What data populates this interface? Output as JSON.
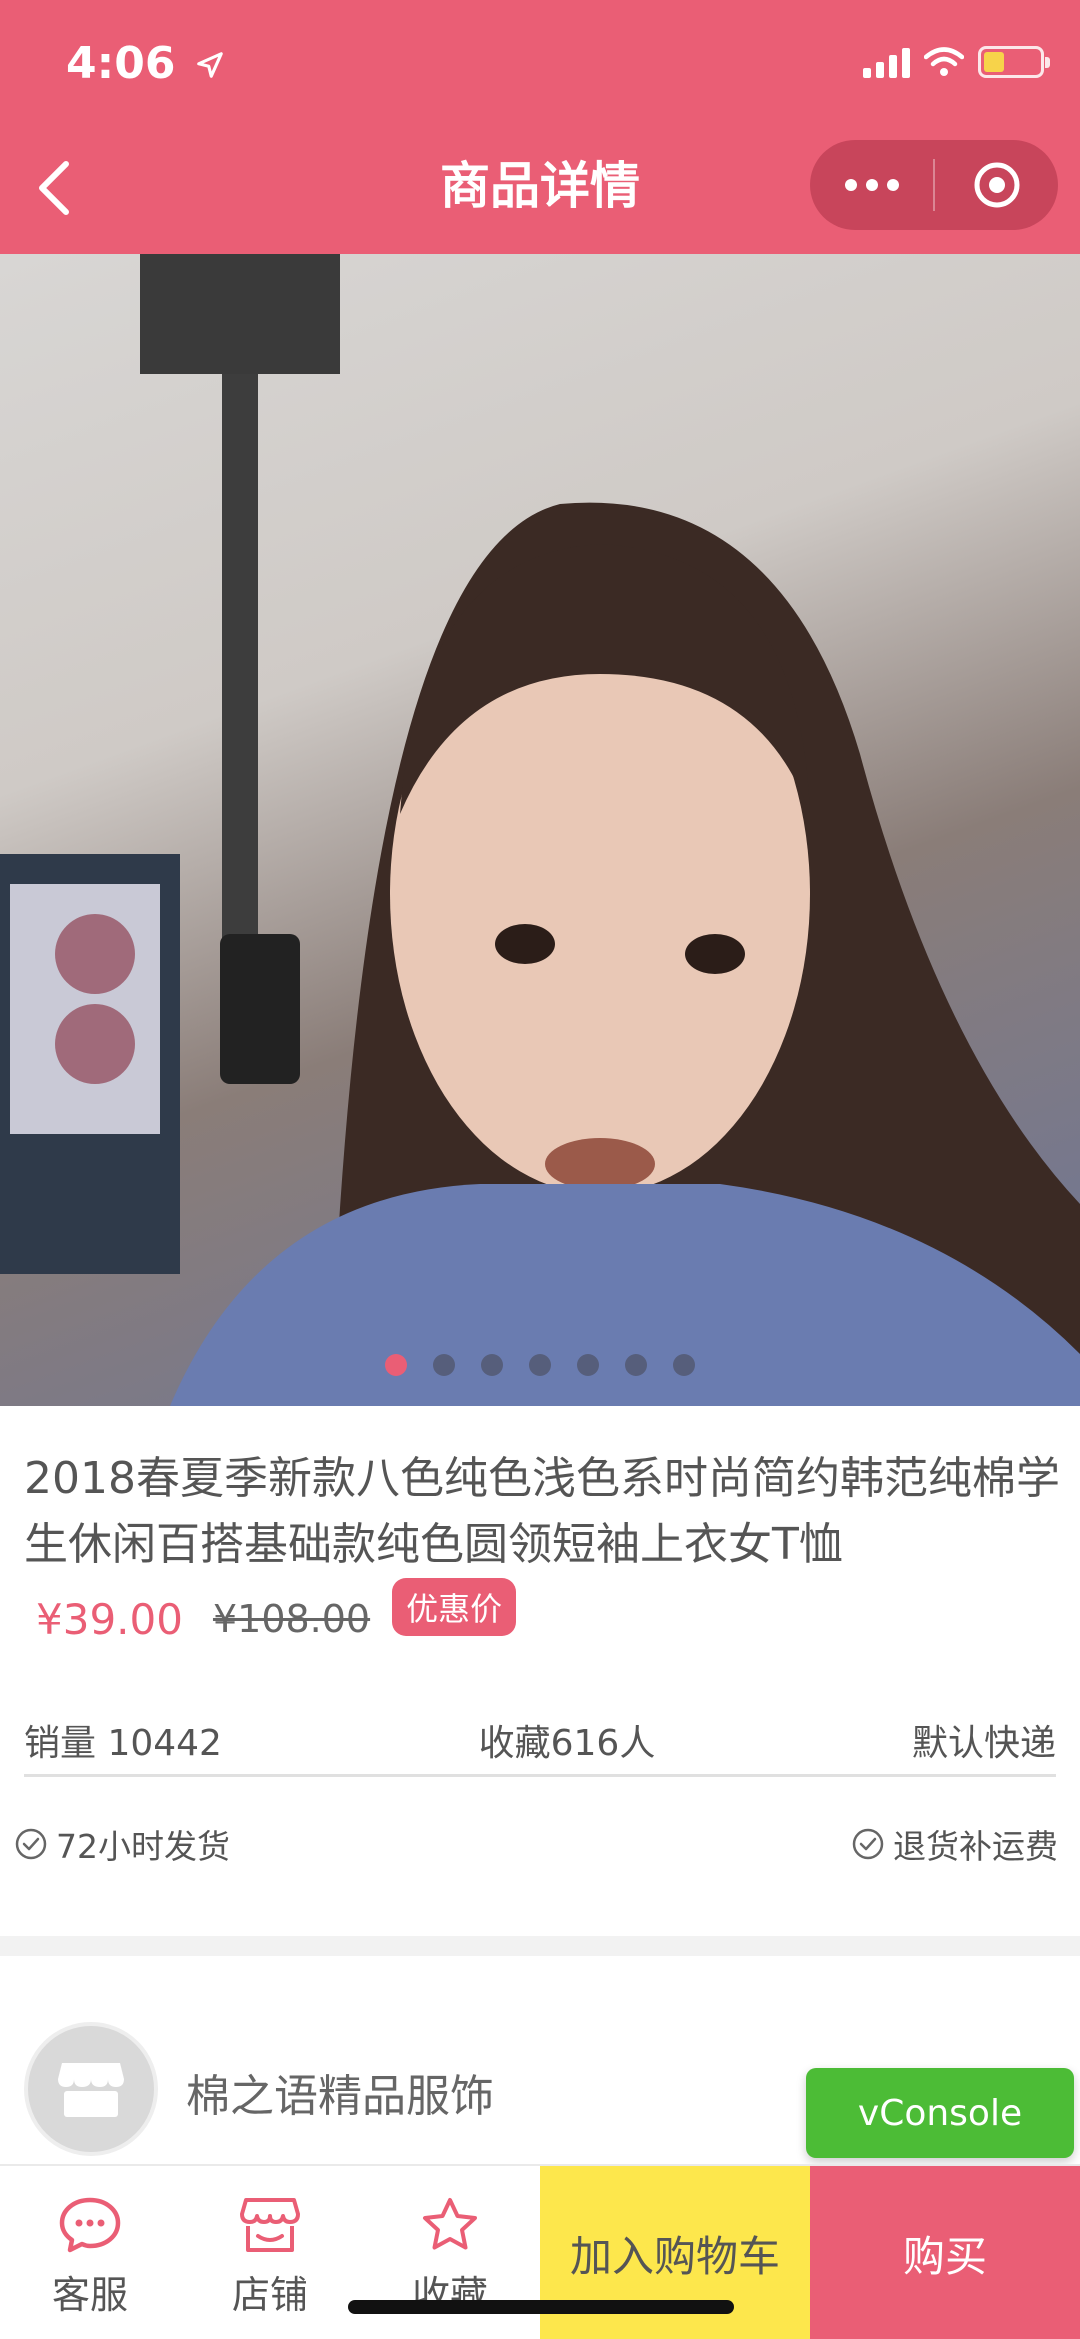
{
  "status_bar": {
    "time": "4:06"
  },
  "header": {
    "title": "商品详情",
    "colors": {
      "header_bg": "#ea5e75"
    }
  },
  "gallery": {
    "slide_count": 7,
    "active_index": 0
  },
  "product": {
    "title": "2018春夏季新款八色纯色浅色系时尚简约韩范纯棉学生休闲百搭基础款纯色圆领短袖上衣女T恤",
    "price": "¥39.00",
    "original_price": "¥108.00",
    "promo_label": "优惠价",
    "sales": "销量 10442",
    "favorites": "收藏616人",
    "shipping": "默认快递",
    "services": [
      "72小时发货",
      "退货补运费"
    ]
  },
  "shop": {
    "name": "棉之语精品服饰"
  },
  "vconsole": {
    "label": "vConsole"
  },
  "bottom_bar": {
    "service_label": "客服",
    "store_label": "店铺",
    "favorite_label": "收藏",
    "add_cart_label": "加入购物车",
    "buy_label": "购买",
    "colors": {
      "accent": "#ea5e75",
      "cart_bg": "#fde74c"
    }
  }
}
